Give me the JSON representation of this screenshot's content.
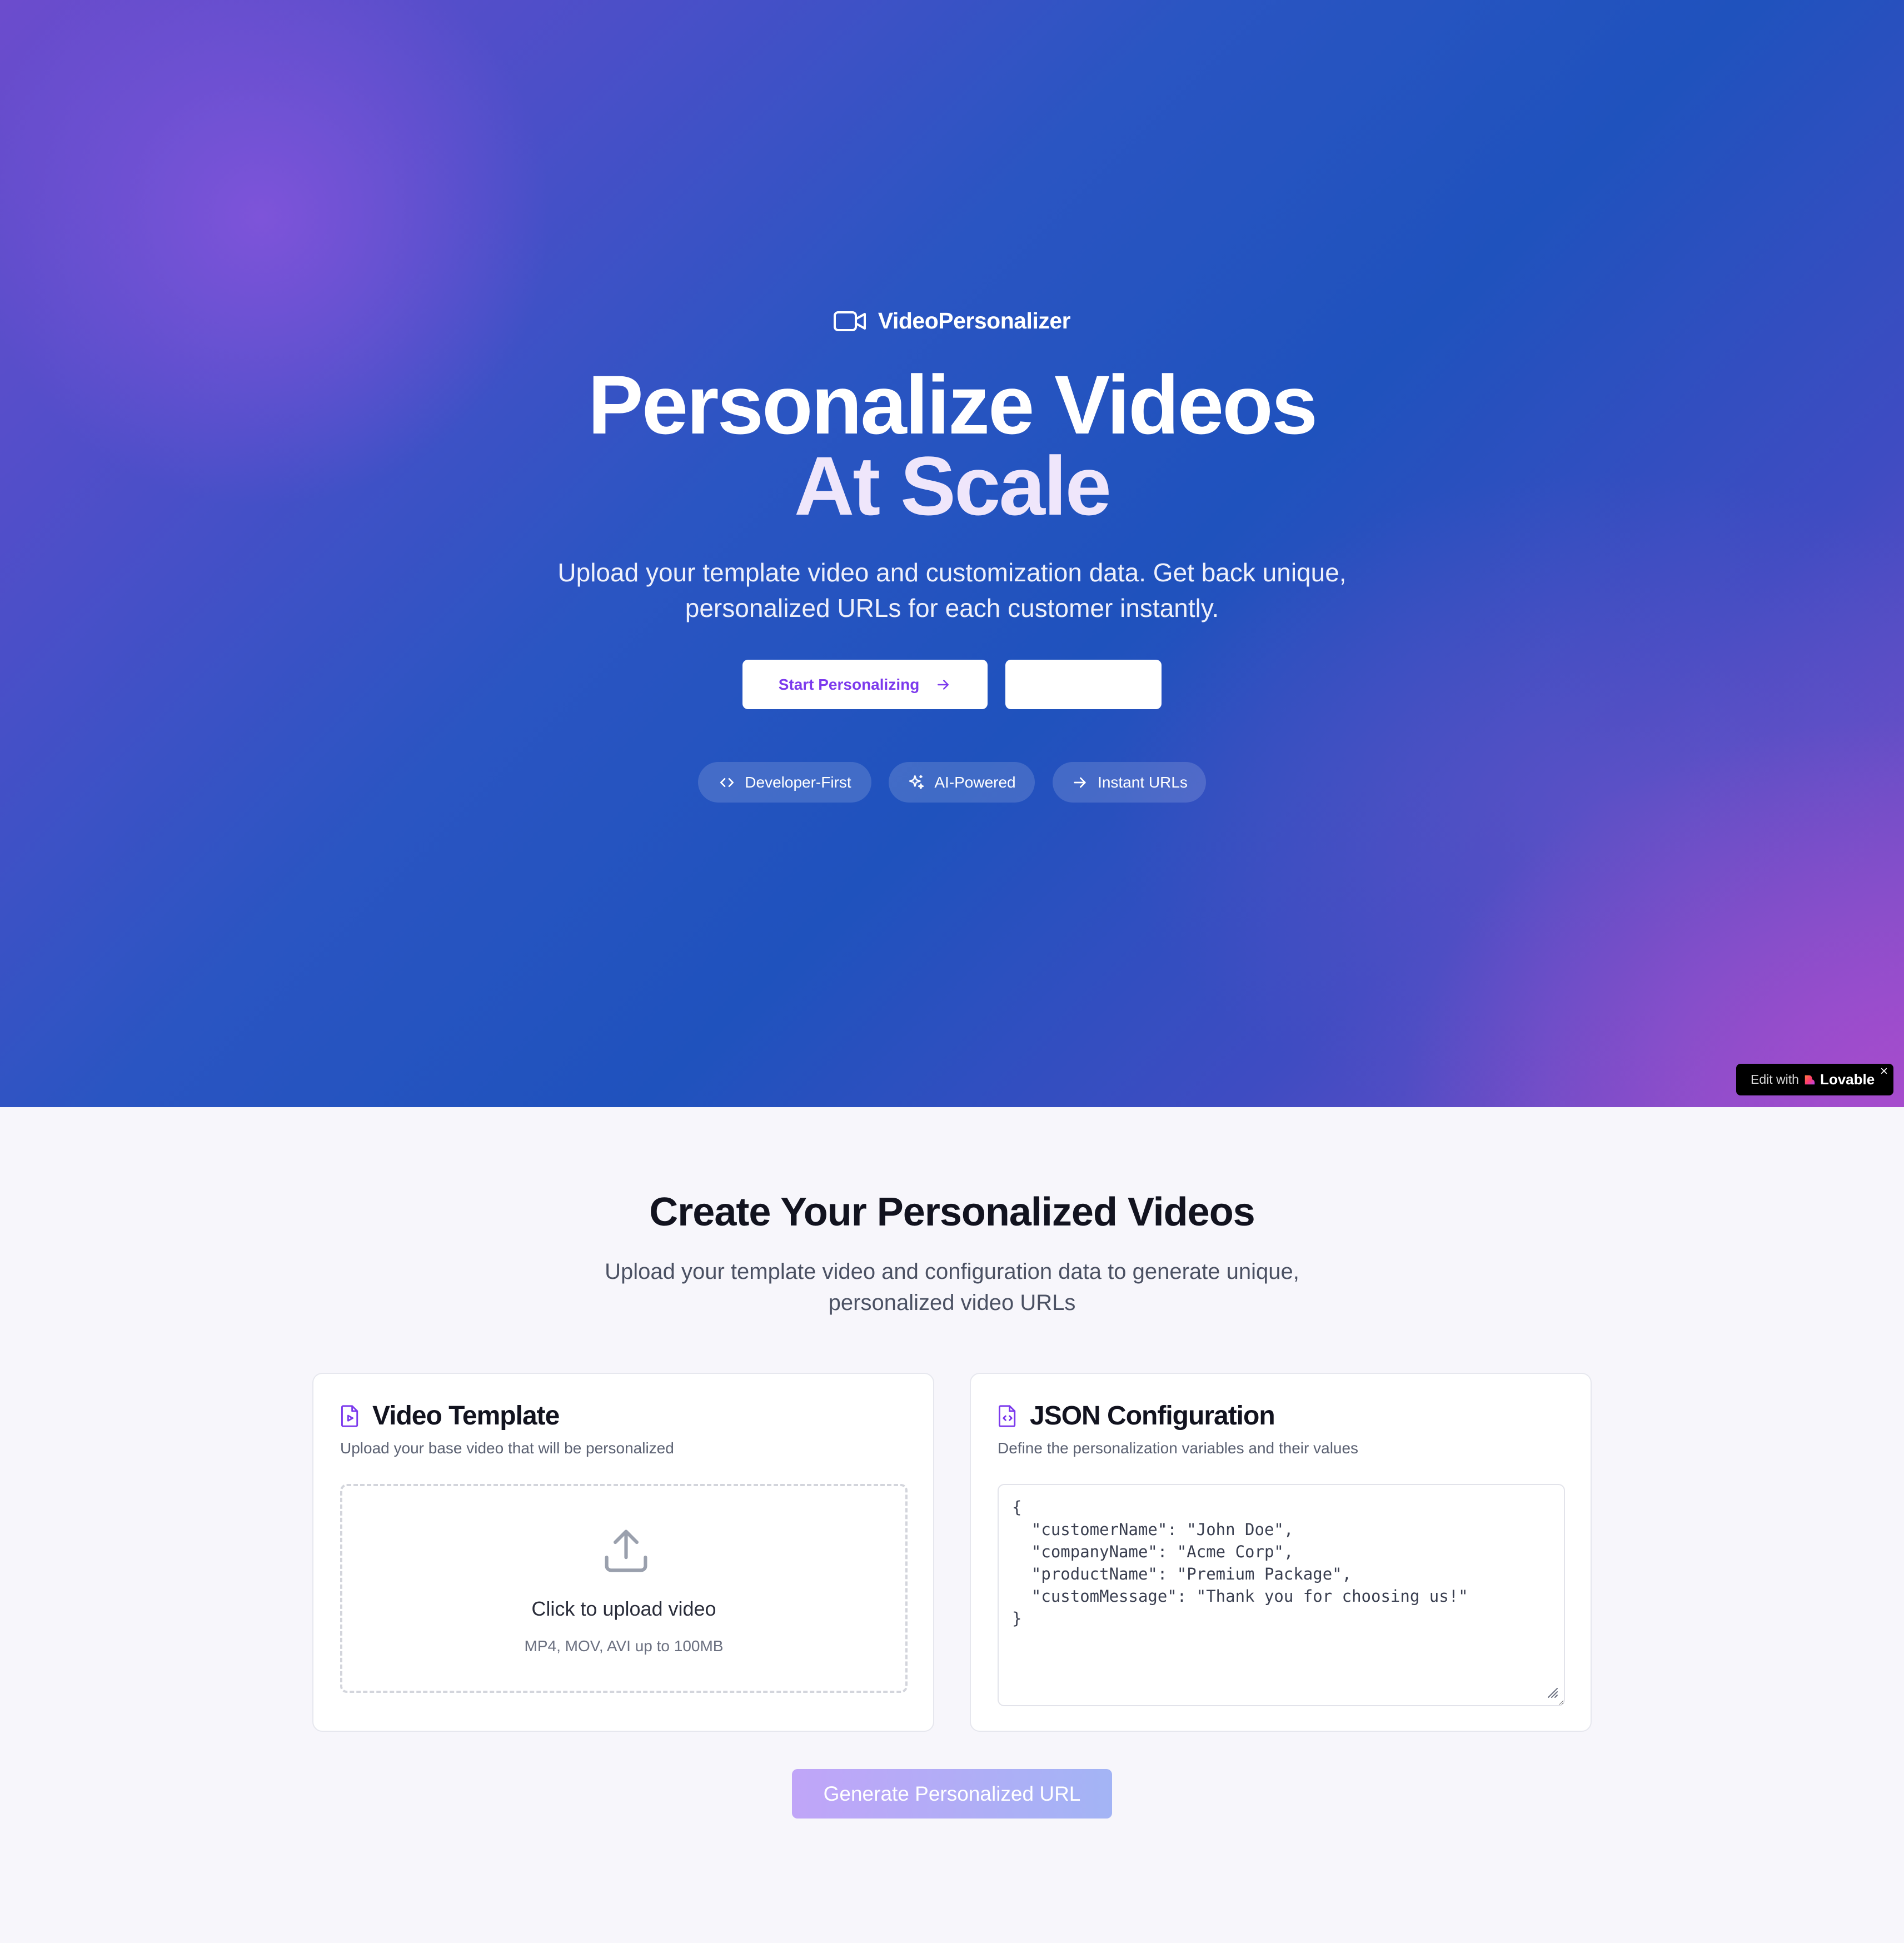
{
  "brand": {
    "name": "VideoPersonalizer",
    "icon": "video-camera-icon"
  },
  "hero": {
    "title_line1": "Personalize Videos",
    "title_line2": "At Scale",
    "subtitle": "Upload your template video and customization data. Get back unique, personalized URLs for each customer instantly.",
    "primary_button": "Start Personalizing",
    "secondary_button": "",
    "features": [
      {
        "label": "Developer-First",
        "icon": "code-icon"
      },
      {
        "label": "AI-Powered",
        "icon": "sparkles-icon"
      },
      {
        "label": "Instant URLs",
        "icon": "arrow-right-icon"
      }
    ]
  },
  "badge": {
    "prefix": "Edit with",
    "name": "Lovable",
    "close": "×"
  },
  "main": {
    "title": "Create Your Personalized Videos",
    "subtitle": "Upload your template video and configuration data to generate unique, personalized video URLs"
  },
  "video_card": {
    "title": "Video Template",
    "description": "Upload your base video that will be personalized",
    "upload_label": "Click to upload video",
    "upload_hint": "MP4, MOV, AVI up to 100MB"
  },
  "json_card": {
    "title": "JSON Configuration",
    "description": "Define the personalization variables and their values",
    "value": "{\n  \"customerName\": \"John Doe\",\n  \"companyName\": \"Acme Corp\",\n  \"productName\": \"Premium Package\",\n  \"customMessage\": \"Thank you for choosing us!\"\n}"
  },
  "generate_button": "Generate Personalized URL",
  "colors": {
    "accent": "#7c3aed",
    "generate_from": "#c0a5f8",
    "generate_to": "#a3b4f5",
    "heading": "#12131f"
  }
}
